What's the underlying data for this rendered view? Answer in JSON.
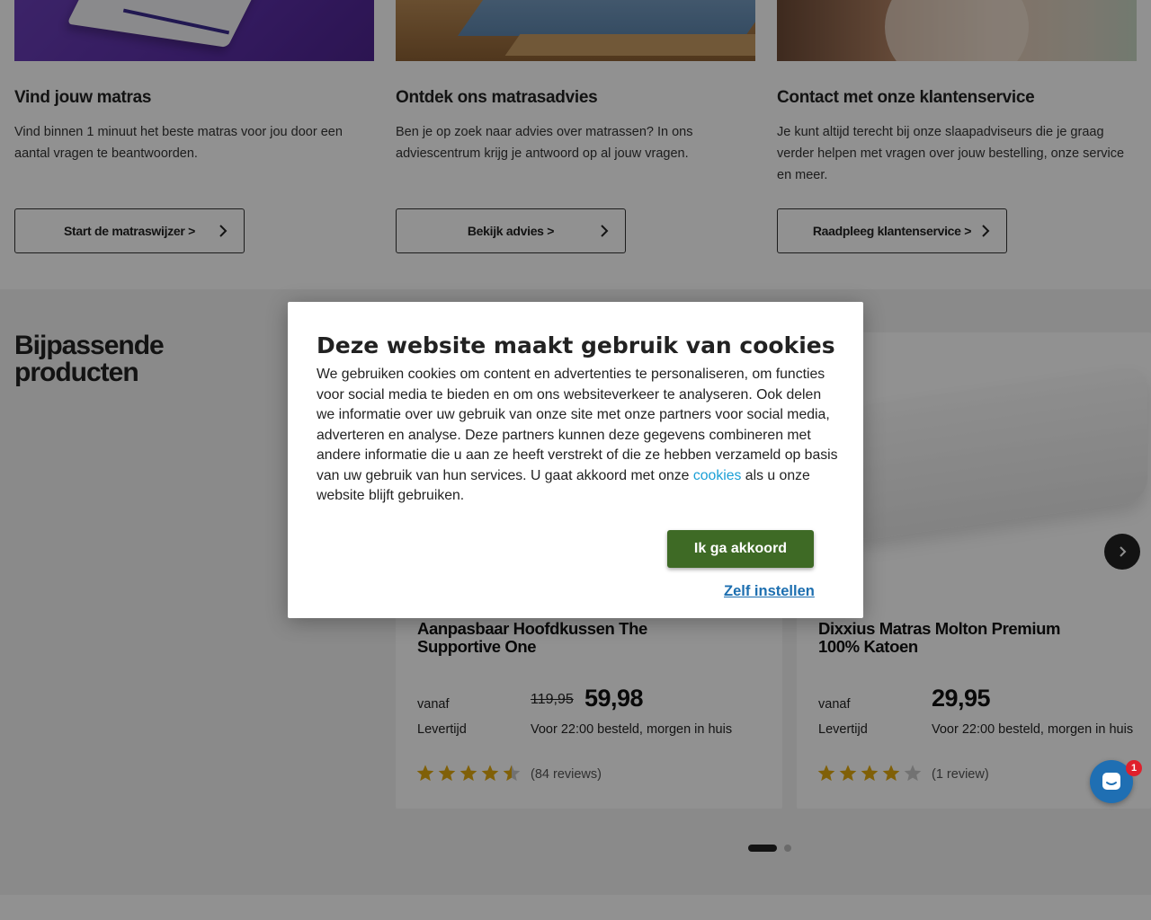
{
  "info_cards": [
    {
      "title": "Vind jouw matras",
      "text": "Vind binnen 1 minuut het beste matras voor jou door een aantal vragen te beantwoorden.",
      "button": "Start de matraswijzer >"
    },
    {
      "title": "Ontdek ons matrasadvies",
      "text": "Ben je op zoek naar advies over matrassen? In ons adviescentrum krijg je antwoord op al jouw vragen.",
      "button": "Bekijk advies >"
    },
    {
      "title": "Contact met onze klantenservice",
      "text": "Je kunt altijd terecht bij onze slaapadviseurs die je graag verder helpen met vragen over jouw bestelling, onze service en meer.",
      "button": "Raadpleeg klantenservice >"
    }
  ],
  "products_section": {
    "heading": "Bijpassende producten",
    "products": [
      {
        "name": "Aanpasbaar Hoofdkussen The Supportive One",
        "from_label": "vanaf",
        "old_price": "119,95",
        "price": "59,98",
        "delivery_label": "Levertijd",
        "delivery": "Voor 22:00 besteld, morgen in huis",
        "rating": 4.5,
        "reviews": "(84 reviews)"
      },
      {
        "name": "Dixxius Matras Molton Premium 100% Katoen",
        "from_label": "vanaf",
        "old_price": "",
        "price": "29,95",
        "delivery_label": "Levertijd",
        "delivery": "Voor 22:00 besteld, morgen in huis",
        "rating": 4,
        "reviews": "(1 review)"
      }
    ],
    "carousel_page": 1,
    "carousel_pages": 2
  },
  "cookie_modal": {
    "title": "Deze website maakt gebruik van cookies",
    "text_before_link": "We gebruiken cookies om content en advertenties te personaliseren, om functies voor social media te bieden en om ons websiteverkeer te analyseren. Ook delen we informatie over uw gebruik van onze site met onze partners voor social media, adverteren en analyse. Deze partners kunnen deze gegevens combineren met andere informatie die u aan ze heeft verstrekt of die ze hebben verzameld op basis van uw gebruik van hun services. U gaat akkoord met onze ",
    "link_text": "cookies",
    "text_after_link": " als u onze website blijft gebruiken.",
    "accept_button": "Ik ga akkoord",
    "settings_link": "Zelf instellen"
  },
  "chat": {
    "badge_count": "1",
    "icon": "chat-icon"
  },
  "colors": {
    "accept_green": "#3e6a25",
    "link_blue": "#1a9fd6",
    "star_gold": "#e2a90f",
    "chat_blue": "#1f6fb3",
    "badge_red": "#e0202c"
  }
}
